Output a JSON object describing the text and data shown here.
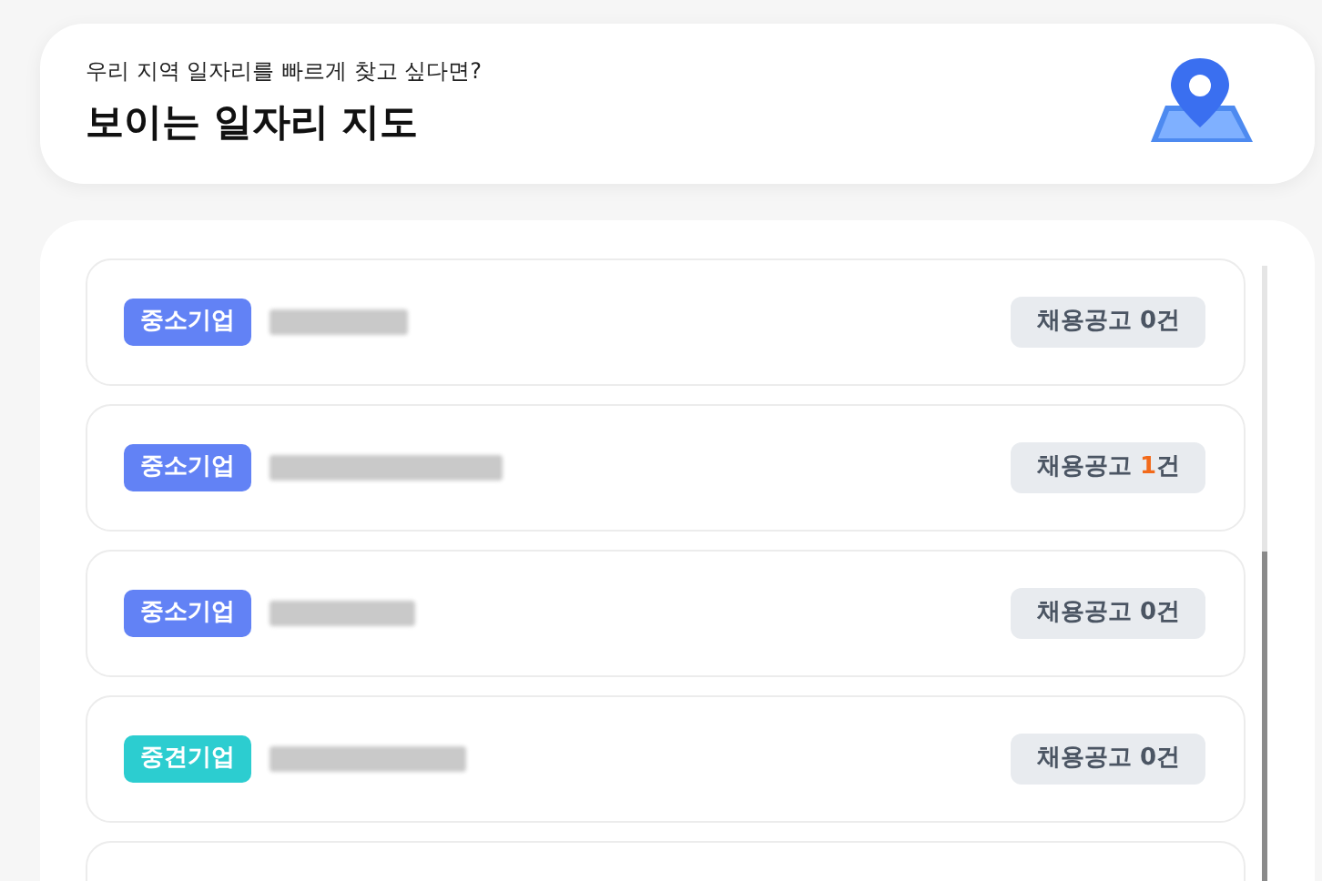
{
  "header": {
    "subtitle": "우리 지역 일자리를 빠르게 찾고 싶다면?",
    "title": "보이는 일자리 지도"
  },
  "companies": [
    {
      "type": "중소기업",
      "color": "#6282f5",
      "postings_label": "채용공고",
      "count": "0",
      "unit": "건",
      "has_postings": false
    },
    {
      "type": "중소기업",
      "color": "#6282f5",
      "postings_label": "채용공고",
      "count": "1",
      "unit": "건",
      "has_postings": true
    },
    {
      "type": "중소기업",
      "color": "#6282f5",
      "postings_label": "채용공고",
      "count": "0",
      "unit": "건",
      "has_postings": false
    },
    {
      "type": "중견기업",
      "color": "#2ccdd0",
      "postings_label": "채용공고",
      "count": "0",
      "unit": "건",
      "has_postings": false
    }
  ]
}
